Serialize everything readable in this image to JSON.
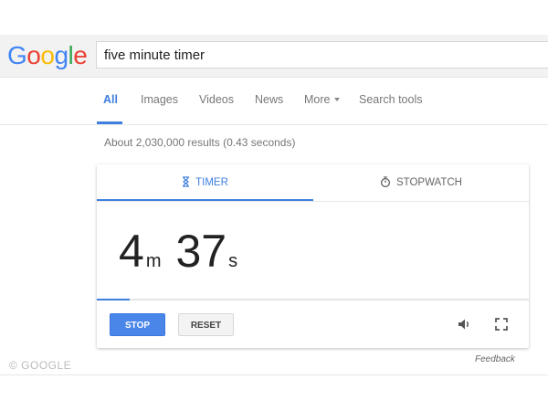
{
  "logo": {
    "letters": [
      "G",
      "o",
      "o",
      "g",
      "l",
      "e"
    ],
    "colors": [
      "#4285f4",
      "#ea4335",
      "#fbbc05",
      "#4285f4",
      "#34a853",
      "#ea4335"
    ]
  },
  "search": {
    "value": "five minute timer"
  },
  "nav": {
    "tabs": [
      {
        "label": "All",
        "active": true
      },
      {
        "label": "Images"
      },
      {
        "label": "Videos"
      },
      {
        "label": "News"
      },
      {
        "label": "More"
      },
      {
        "label": "Search tools"
      }
    ]
  },
  "results": {
    "stats": "About 2,030,000 results (0.43 seconds)"
  },
  "timer_card": {
    "tabs": {
      "timer": "TIMER",
      "stopwatch": "STOPWATCH"
    },
    "display": {
      "minutes": "4",
      "minutes_unit": "m",
      "seconds": "37",
      "seconds_unit": "s"
    },
    "progress_fraction": 0.077,
    "buttons": {
      "stop": "STOP",
      "reset": "RESET"
    },
    "icons": {
      "timer_tab": "hourglass-icon",
      "stopwatch_tab": "stopwatch-icon",
      "sound": "speaker-icon",
      "fullscreen": "fullscreen-icon"
    }
  },
  "footer": {
    "copyright": "© GOOGLE",
    "feedback": "Feedback"
  },
  "accent_color": "#3f7fe0"
}
